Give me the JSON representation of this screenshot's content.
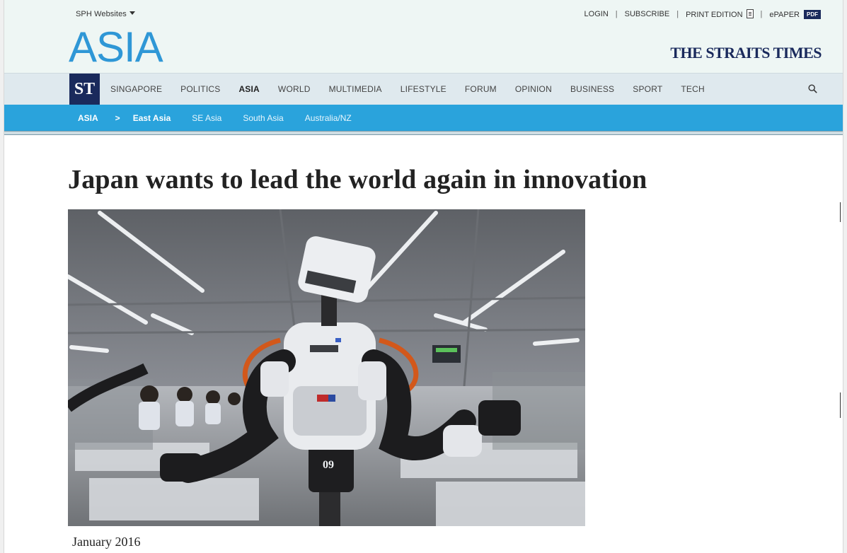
{
  "masthead": {
    "sph_label": "SPH Websites",
    "links": {
      "login": "LOGIN",
      "subscribe": "SUBSCRIBE",
      "print_edition": "PRINT EDITION",
      "epaper": "ePAPER",
      "pdf_badge": "PDF",
      "separator": "|"
    },
    "section_title": "ASIA",
    "brand": "THE STRAITS TIMES"
  },
  "nav": {
    "logo": "ST",
    "items": [
      "SINGAPORE",
      "POLITICS",
      "ASIA",
      "WORLD",
      "MULTIMEDIA",
      "LIFESTYLE",
      "FORUM",
      "OPINION",
      "BUSINESS",
      "SPORT",
      "TECH"
    ],
    "active": "ASIA"
  },
  "subnav": {
    "section": "ASIA",
    "chevron": ">",
    "items": [
      "East Asia",
      "SE Asia",
      "South Asia",
      "Australia/NZ"
    ],
    "active": "East Asia"
  },
  "article": {
    "headline": "Japan wants to lead the world again in innovation",
    "robot_number": "09",
    "date": "January 2016"
  },
  "colors": {
    "accent_blue": "#2aa3dc",
    "brand_navy": "#1a2a5c",
    "title_blue": "#2f97d6"
  }
}
